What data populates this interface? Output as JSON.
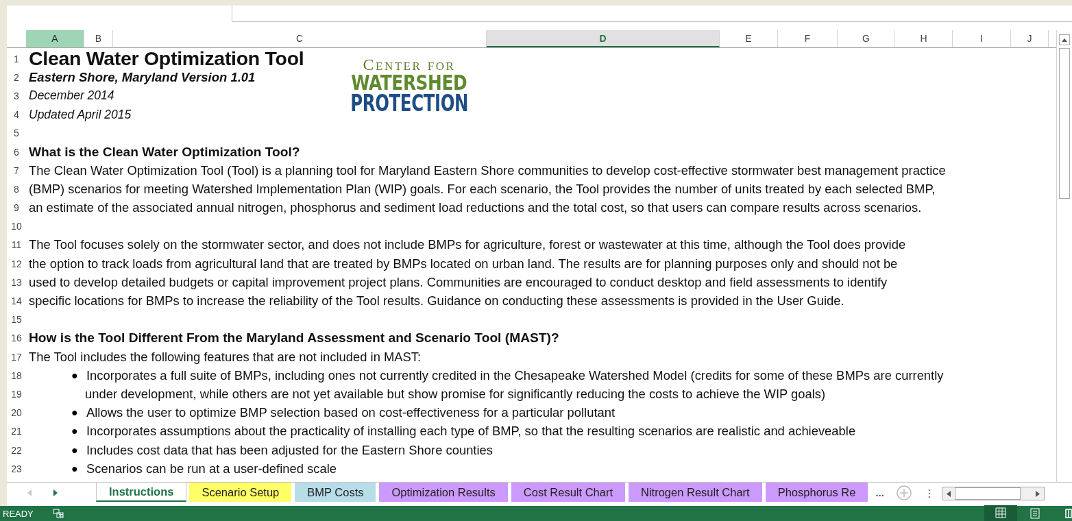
{
  "columns": [
    {
      "label": "A",
      "selected": true
    },
    {
      "label": "B",
      "selected": false
    },
    {
      "label": "C",
      "selected": false
    },
    {
      "label": "D",
      "selected": true
    },
    {
      "label": "E",
      "selected": false
    },
    {
      "label": "F",
      "selected": false
    },
    {
      "label": "G",
      "selected": false
    },
    {
      "label": "H",
      "selected": false
    },
    {
      "label": "I",
      "selected": false
    },
    {
      "label": "J",
      "selected": false
    }
  ],
  "logo": {
    "line_1": "Center for",
    "line_2": "WATERSHED",
    "line_3": "PROTECTION"
  },
  "rows": [
    {
      "number": "1",
      "kind": "title",
      "text": "Clean Water Optimization Tool"
    },
    {
      "number": "2",
      "kind": "subtitle",
      "text": "Eastern Shore, Maryland Version 1.01"
    },
    {
      "number": "3",
      "kind": "italic",
      "text": "December 2014"
    },
    {
      "number": "4",
      "kind": "italic",
      "text": "Updated April 2015"
    },
    {
      "number": "5",
      "kind": "blank"
    },
    {
      "number": "6",
      "kind": "heading",
      "text": "What is the Clean Water Optimization Tool?"
    },
    {
      "number": "7",
      "kind": "body",
      "text": "The Clean Water Optimization Tool (Tool) is a planning tool for Maryland Eastern Shore communities to develop cost-effective stormwater best management practice"
    },
    {
      "number": "8",
      "kind": "body",
      "text": "(BMP) scenarios for meeting Watershed Implementation Plan (WIP) goals. For each scenario, the Tool provides the number of units treated by each selected BMP,"
    },
    {
      "number": "9",
      "kind": "body",
      "text": "an estimate of the associated annual nitrogen, phosphorus and sediment load reductions and the total cost, so that users can compare results across scenarios."
    },
    {
      "number": "10",
      "kind": "blank"
    },
    {
      "number": "11",
      "kind": "body",
      "text": "The Tool focuses solely on the stormwater sector, and does not include BMPs for agriculture, forest or wastewater at this time, although the Tool does provide"
    },
    {
      "number": "12",
      "kind": "body",
      "text": "the option to track loads from agricultural land that are treated by BMPs located on urban land.  The results are for planning purposes only and should not be"
    },
    {
      "number": "13",
      "kind": "body",
      "text": "used to develop detailed budgets or capital improvement project plans.  Communities are encouraged to conduct desktop and field assessments to identify"
    },
    {
      "number": "14",
      "kind": "body",
      "text": "specific locations for BMPs to increase the reliability of the Tool results.  Guidance on conducting these assessments is provided in the User Guide."
    },
    {
      "number": "15",
      "kind": "blank"
    },
    {
      "number": "16",
      "kind": "heading",
      "text": "How is the Tool Different From the Maryland Assessment and Scenario Tool (MAST)?"
    },
    {
      "number": "17",
      "kind": "body",
      "text": "The Tool includes the following features that are not included in MAST:"
    },
    {
      "number": "18",
      "kind": "bullet",
      "bullet": "●",
      "text": "Incorporates a full suite of BMPs, including ones not currently credited in the Chesapeake Watershed Model (credits for some of these BMPs are currently"
    },
    {
      "number": "19",
      "kind": "continuation",
      "text": "under development, while others are not yet available but show promise for significantly reducing the costs to achieve the WIP goals)"
    },
    {
      "number": "20",
      "kind": "bullet",
      "bullet": "●",
      "text": "Allows the user to optimize BMP selection based on cost-effectiveness for a particular pollutant"
    },
    {
      "number": "21",
      "kind": "bullet",
      "bullet": "●",
      "text": "Incorporates assumptions about the practicality of installing each type of BMP, so that the resulting scenarios are realistic and achieveable"
    },
    {
      "number": "22",
      "kind": "bullet",
      "bullet": "●",
      "text": "Includes cost data that has been adjusted for the Eastern Shore counties"
    },
    {
      "number": "23",
      "kind": "bullet",
      "bullet": "●",
      "text": "Scenarios can be run at a user-defined scale"
    }
  ],
  "sheet_tabs": [
    {
      "label": "Instructions",
      "selected": true,
      "color": "#ffffff"
    },
    {
      "label": "Scenario Setup",
      "selected": false,
      "color": "#ffff66"
    },
    {
      "label": "BMP Costs",
      "selected": false,
      "color": "#b7dde8"
    },
    {
      "label": "Optimization Results",
      "selected": false,
      "color": "#cc99ff"
    },
    {
      "label": "Cost Result Chart",
      "selected": false,
      "color": "#cc99ff"
    },
    {
      "label": "Nitrogen Result Chart",
      "selected": false,
      "color": "#cc99ff"
    },
    {
      "label": "Phosphorus Re",
      "selected": false,
      "color": "#cc99ff"
    }
  ],
  "more_tabs": "...",
  "status_bar": {
    "mode": "READY"
  }
}
